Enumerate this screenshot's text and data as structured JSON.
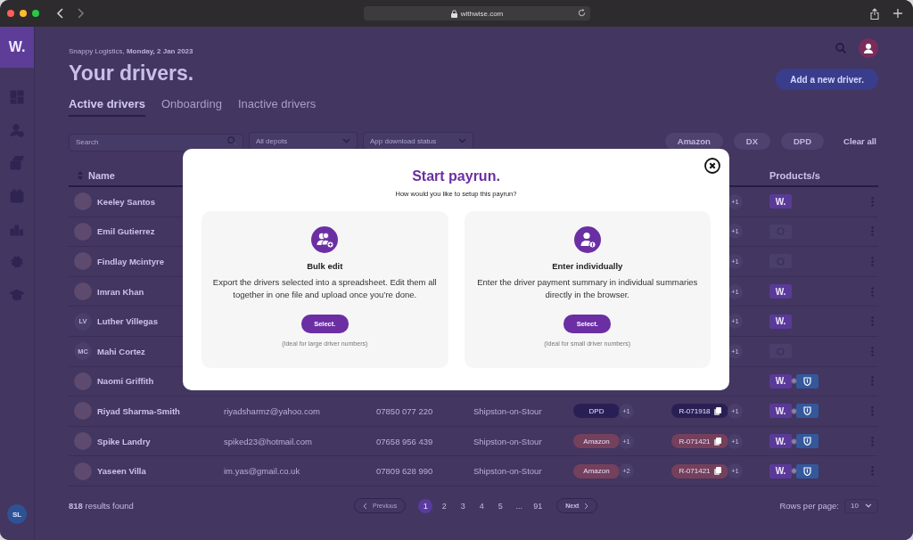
{
  "browser": {
    "url": "withwise.com"
  },
  "sidebar": {
    "logo": "W.",
    "user_initials": "SL"
  },
  "header": {
    "greeting": "Snappy Logistics, **Monday, 2 Jan 2023**",
    "title": "Your drivers.",
    "add_button": "Add a new driver."
  },
  "tabs": [
    {
      "label": "Active drivers",
      "selected": true
    },
    {
      "label": "Onboarding",
      "selected": false
    },
    {
      "label": "Inactive drivers",
      "selected": false
    }
  ],
  "filters": {
    "search": {
      "placeholder": "Search"
    },
    "depot": {
      "placeholder": "All depots"
    },
    "app_status": {
      "placeholder": "App download status"
    },
    "chips": [
      "Amazon",
      "DX",
      "DPD"
    ],
    "clear": "Clear all"
  },
  "table": {
    "columns": [
      "Name",
      "Products/s"
    ],
    "rows": [
      {
        "name": "Keeley Santos",
        "avatar": {
          "kind": "photo"
        },
        "route_more": "+1",
        "products": [
          {
            "kind": "withwise",
            "label": "W."
          }
        ]
      },
      {
        "name": "Emil Gutierrez",
        "avatar": {
          "kind": "photo"
        },
        "route_more": "+1",
        "products": [
          {
            "kind": "pending"
          }
        ]
      },
      {
        "name": "Findlay Mcintyre",
        "avatar": {
          "kind": "photo"
        },
        "route_more": "+1",
        "products": [
          {
            "kind": "pending"
          }
        ]
      },
      {
        "name": "Imran Khan",
        "avatar": {
          "kind": "photo"
        },
        "route_more": "+1",
        "products": [
          {
            "kind": "withwise",
            "label": "W."
          }
        ]
      },
      {
        "name": "Luther Villegas",
        "avatar": {
          "kind": "initials",
          "text": "LV"
        },
        "route_more": "+1",
        "products": [
          {
            "kind": "withwise",
            "label": "W."
          }
        ]
      },
      {
        "name": "Mahi Cortez",
        "avatar": {
          "kind": "initials",
          "text": "MC"
        },
        "route_more": "+1",
        "products": [
          {
            "kind": "pending"
          }
        ]
      },
      {
        "name": "Naomi Griffith",
        "avatar": {
          "kind": "photo"
        },
        "products": [
          {
            "kind": "withwise",
            "label": "W."
          },
          {
            "kind": "shield"
          }
        ]
      },
      {
        "name": "Riyad Sharma-Smith",
        "avatar": {
          "kind": "photo"
        },
        "email": "riyadsharmz@yahoo.com",
        "phone": "07850 077 220",
        "depot": "Shipston-on-Stour",
        "service": {
          "label": "DPD",
          "color": "#2a1f55"
        },
        "service_more": "+1",
        "route": {
          "label": "R-071918",
          "color": "#2a1f55"
        },
        "route_more": "+1",
        "products": [
          {
            "kind": "withwise",
            "label": "W."
          },
          {
            "kind": "shield"
          }
        ]
      },
      {
        "name": "Spike Landry",
        "avatar": {
          "kind": "photo"
        },
        "email": "spiked23@hotmail.com",
        "phone": "07658 956 439",
        "depot": "Shipston-on-Stour",
        "service": {
          "label": "Amazon",
          "color": "#74405c"
        },
        "service_more": "+1",
        "route": {
          "label": "R-071421",
          "color": "#74405c"
        },
        "route_more": "+1",
        "products": [
          {
            "kind": "withwise",
            "label": "W."
          },
          {
            "kind": "shield"
          }
        ]
      },
      {
        "name": "Yaseen Villa",
        "avatar": {
          "kind": "photo"
        },
        "email": "im.yas@gmail.co.uk",
        "phone": "07809 628 990",
        "depot": "Shipston-on-Stour",
        "service": {
          "label": "Amazon",
          "color": "#74405c"
        },
        "service_more": "+2",
        "route": {
          "label": "R-071421",
          "color": "#74405c"
        },
        "route_more": "+1",
        "products": [
          {
            "kind": "withwise",
            "label": "W."
          },
          {
            "kind": "shield"
          }
        ]
      }
    ]
  },
  "footer": {
    "results": "**818** results found",
    "previous": "Previous",
    "pages": [
      {
        "label": "1",
        "selected": true
      },
      {
        "label": "2",
        "selected": false
      },
      {
        "label": "3",
        "selected": false
      },
      {
        "label": "4",
        "selected": false
      },
      {
        "label": "5",
        "selected": false
      },
      {
        "label": "...",
        "selected": false
      },
      {
        "label": "91",
        "selected": false
      }
    ],
    "next": "Next",
    "rows_per_page_label": "Rows per page:",
    "rows_per_page": "10"
  },
  "modal": {
    "title": "Start payrun.",
    "subtitle": "How would you like to setup this payrun?",
    "options": [
      {
        "kind": "bulk",
        "title": "Bulk edit",
        "description": "Export the drivers selected into a spreadsheet. Edit them all together in one file and upload once you’re done.",
        "button": "Select.",
        "note": "(Ideal for large driver numbers)"
      },
      {
        "kind": "individual",
        "title": "Enter individually",
        "description": "Enter the driver payment summary in individual summaries directly in the browser.",
        "button": "Select.",
        "note": "(Ideal for small driver numbers)"
      }
    ]
  }
}
